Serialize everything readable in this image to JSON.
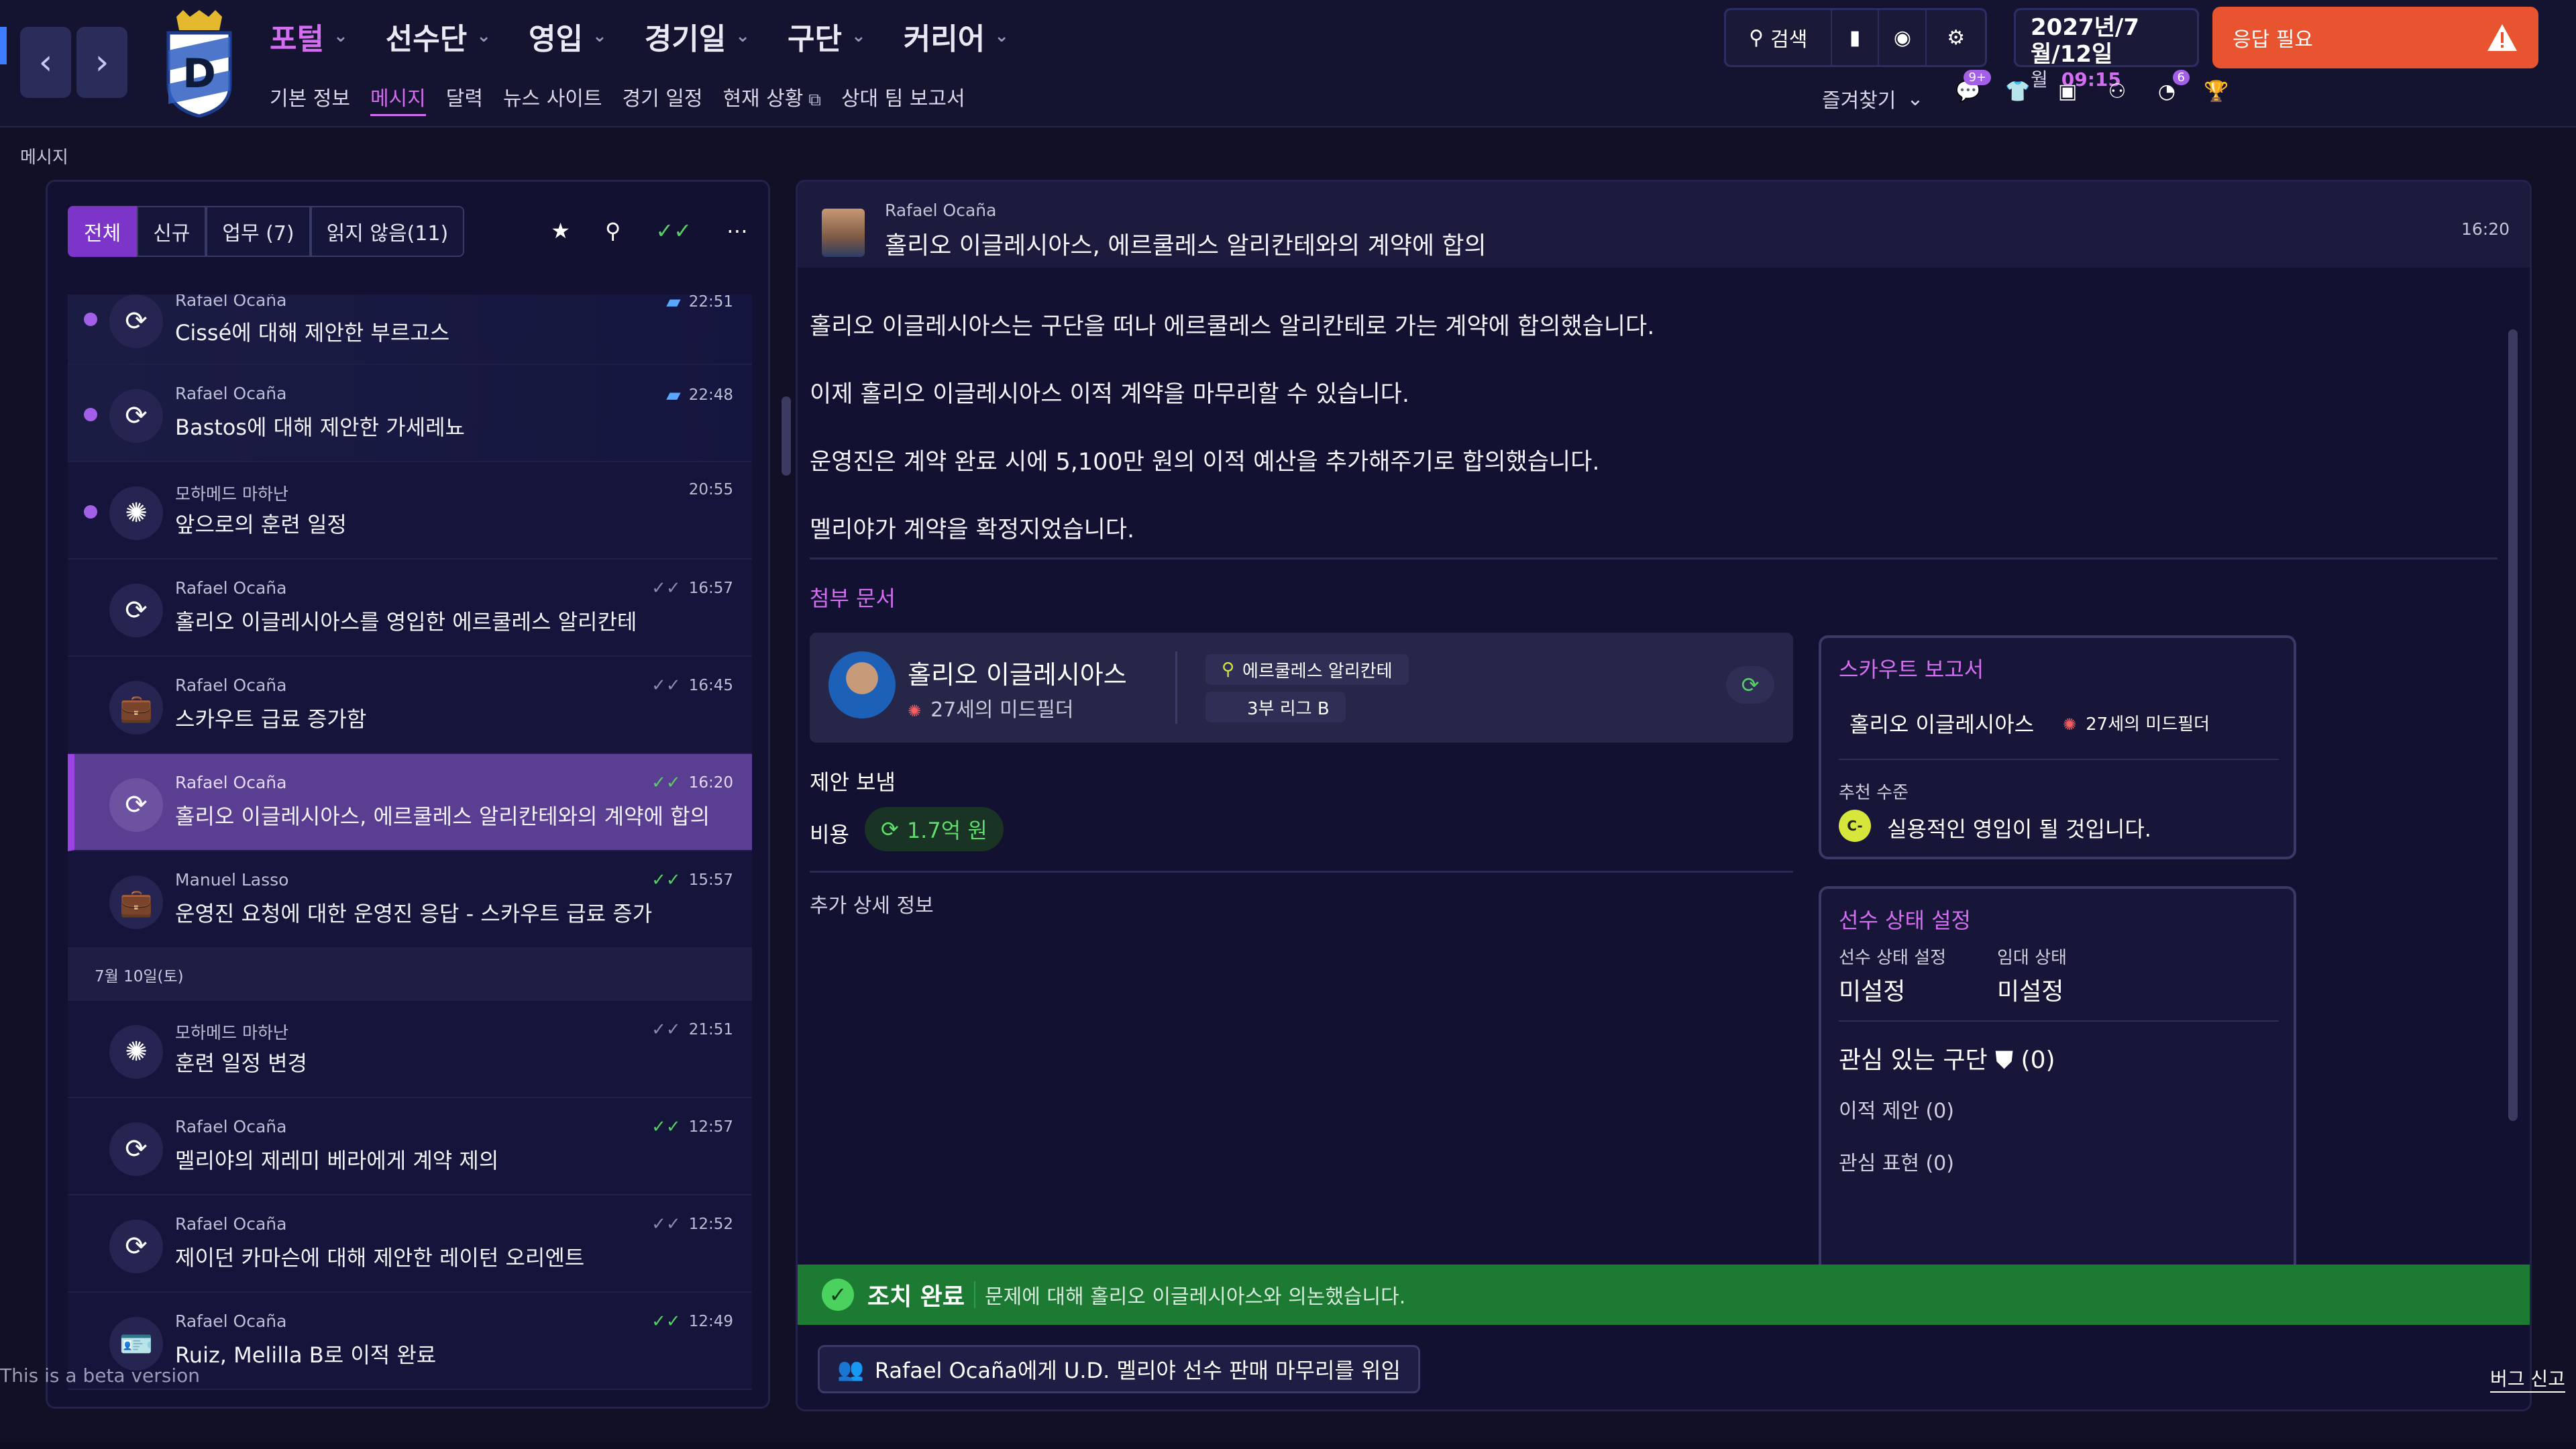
{
  "topbar": {
    "menu": [
      {
        "label": "포털",
        "active": true
      },
      {
        "label": "선수단"
      },
      {
        "label": "영입"
      },
      {
        "label": "경기일"
      },
      {
        "label": "구단"
      },
      {
        "label": "커리어"
      }
    ],
    "submenu": [
      "기본 정보",
      "메시지",
      "달력",
      "뉴스 사이트",
      "경기 일정",
      "현재 상황",
      "상대 팀 보고서"
    ],
    "search_label": "검색",
    "date_line1": "2027년/7월/12일",
    "date_weekday": "월",
    "date_time": "09:15",
    "alert_label": "응답 필요",
    "bookmarks_label": "즐겨찾기",
    "badges": {
      "chat": "9+",
      "notify": "6"
    }
  },
  "page_title": "메시지",
  "inbox": {
    "filters": [
      "전체",
      "신규",
      "업무 (7)",
      "읽지 않음(11)"
    ],
    "messages": [
      {
        "sender": "Rafael Ocaña",
        "subject": "Cissé에 대해 제안한 부르고스",
        "time": "22:51",
        "unread": true,
        "icon": "transfer-icon",
        "status": "bubble"
      },
      {
        "sender": "Rafael Ocaña",
        "subject": "Bastos에 대해 제안한 가세레뇨",
        "time": "22:48",
        "unread": true,
        "icon": "transfer-icon",
        "status": "bubble"
      },
      {
        "sender": "모하메드 마하난",
        "subject": "앞으로의 훈련 일정",
        "time": "20:55",
        "unread": true,
        "icon": "training-icon",
        "status": "none"
      },
      {
        "sender": "Rafael Ocaña",
        "subject": "홀리오 이글레시아스를 영입한 에르쿨레스 알리칸테",
        "time": "16:57",
        "icon": "transfer-icon",
        "status": "read"
      },
      {
        "sender": "Rafael Ocaña",
        "subject": "스카우트 급료 증가함",
        "time": "16:45",
        "icon": "briefcase-icon",
        "status": "read"
      },
      {
        "sender": "Rafael Ocaña",
        "subject": "홀리오 이글레시아스, 에르쿨레스 알리칸테와의 계약에 합의",
        "time": "16:20",
        "selected": true,
        "icon": "transfer-icon",
        "status": "done"
      },
      {
        "sender": "Manuel Lasso",
        "subject": "운영진 요청에 대한 운영진 응답 - 스카우트 급료 증가",
        "time": "15:57",
        "icon": "briefcase-icon",
        "status": "done"
      }
    ],
    "date_separator": "7월 10일(토)",
    "messages2": [
      {
        "sender": "모하메드 마하난",
        "subject": "훈련 일정 변경",
        "time": "21:51",
        "icon": "training-icon",
        "status": "read"
      },
      {
        "sender": "Rafael Ocaña",
        "subject": "멜리야의 제레미 베라에게 계약 제의",
        "time": "12:57",
        "icon": "transfer-icon",
        "status": "done"
      },
      {
        "sender": "Rafael Ocaña",
        "subject": "제이던 카마슨에 대해 제안한 레이턴 오리엔트",
        "time": "12:52",
        "icon": "transfer-icon",
        "status": "read"
      },
      {
        "sender": "Rafael Ocaña",
        "subject": "Ruiz, Melilla B로 이적 완료",
        "time": "12:49",
        "icon": "id-card-icon",
        "status": "done"
      }
    ]
  },
  "message": {
    "sender": "Rafael Ocaña",
    "subject": "홀리오 이글레시아스, 에르쿨레스 알리칸테와의 계약에 합의",
    "time": "16:20",
    "body": [
      "홀리오 이글레시아스는 구단을 떠나 에르쿨레스 알리칸테로 가는 계약에 합의했습니다.",
      "이제 홀리오 이글레시아스 이적 계약을 마무리할 수 있습니다.",
      "운영진은 계약 완료 시에 5,100만 원의 이적 예산을 추가해주기로 합의했습니다.",
      "멜리야가 계약을 확정지었습니다."
    ],
    "attachments_title": "첨부 문서",
    "player": {
      "name": "홀리오 이글레시아스",
      "age_pos": "27세의 미드필더",
      "club": "에르쿨레스 알리칸테",
      "league": "3부 리그 B"
    },
    "offer_sent": "제안 보냄",
    "fee_label": "비용",
    "fee_value": "1.7억 원",
    "extra_info": "추가 상세 정보",
    "scout": {
      "title": "스카우트 보고서",
      "name": "홀리오 이글레시아스",
      "age_pos": "27세의 미드필더",
      "rec_label": "추천 수준",
      "rec_grade": "C-",
      "rec_text": "실용적인 영입이 될 것입니다."
    },
    "status": {
      "title": "선수 상태 설정",
      "label1": "선수 상태 설정",
      "value1": "미설정",
      "label2": "임대 상태",
      "value2": "미설정",
      "interested": "관심 있는 구단",
      "interested_count": "(0)",
      "offers": "이적 제안 (0)",
      "expressions": "관심 표현 (0)"
    },
    "action_title": "조치 완료",
    "action_desc": "문제에 대해 홀리오 이글레시아스와 의논했습니다.",
    "delegate": "Rafael Ocaña에게 U.D. 멜리야 선수 판매 마무리를 위임"
  },
  "footer": {
    "beta": "This is a beta version",
    "bug": "버그 신고"
  }
}
